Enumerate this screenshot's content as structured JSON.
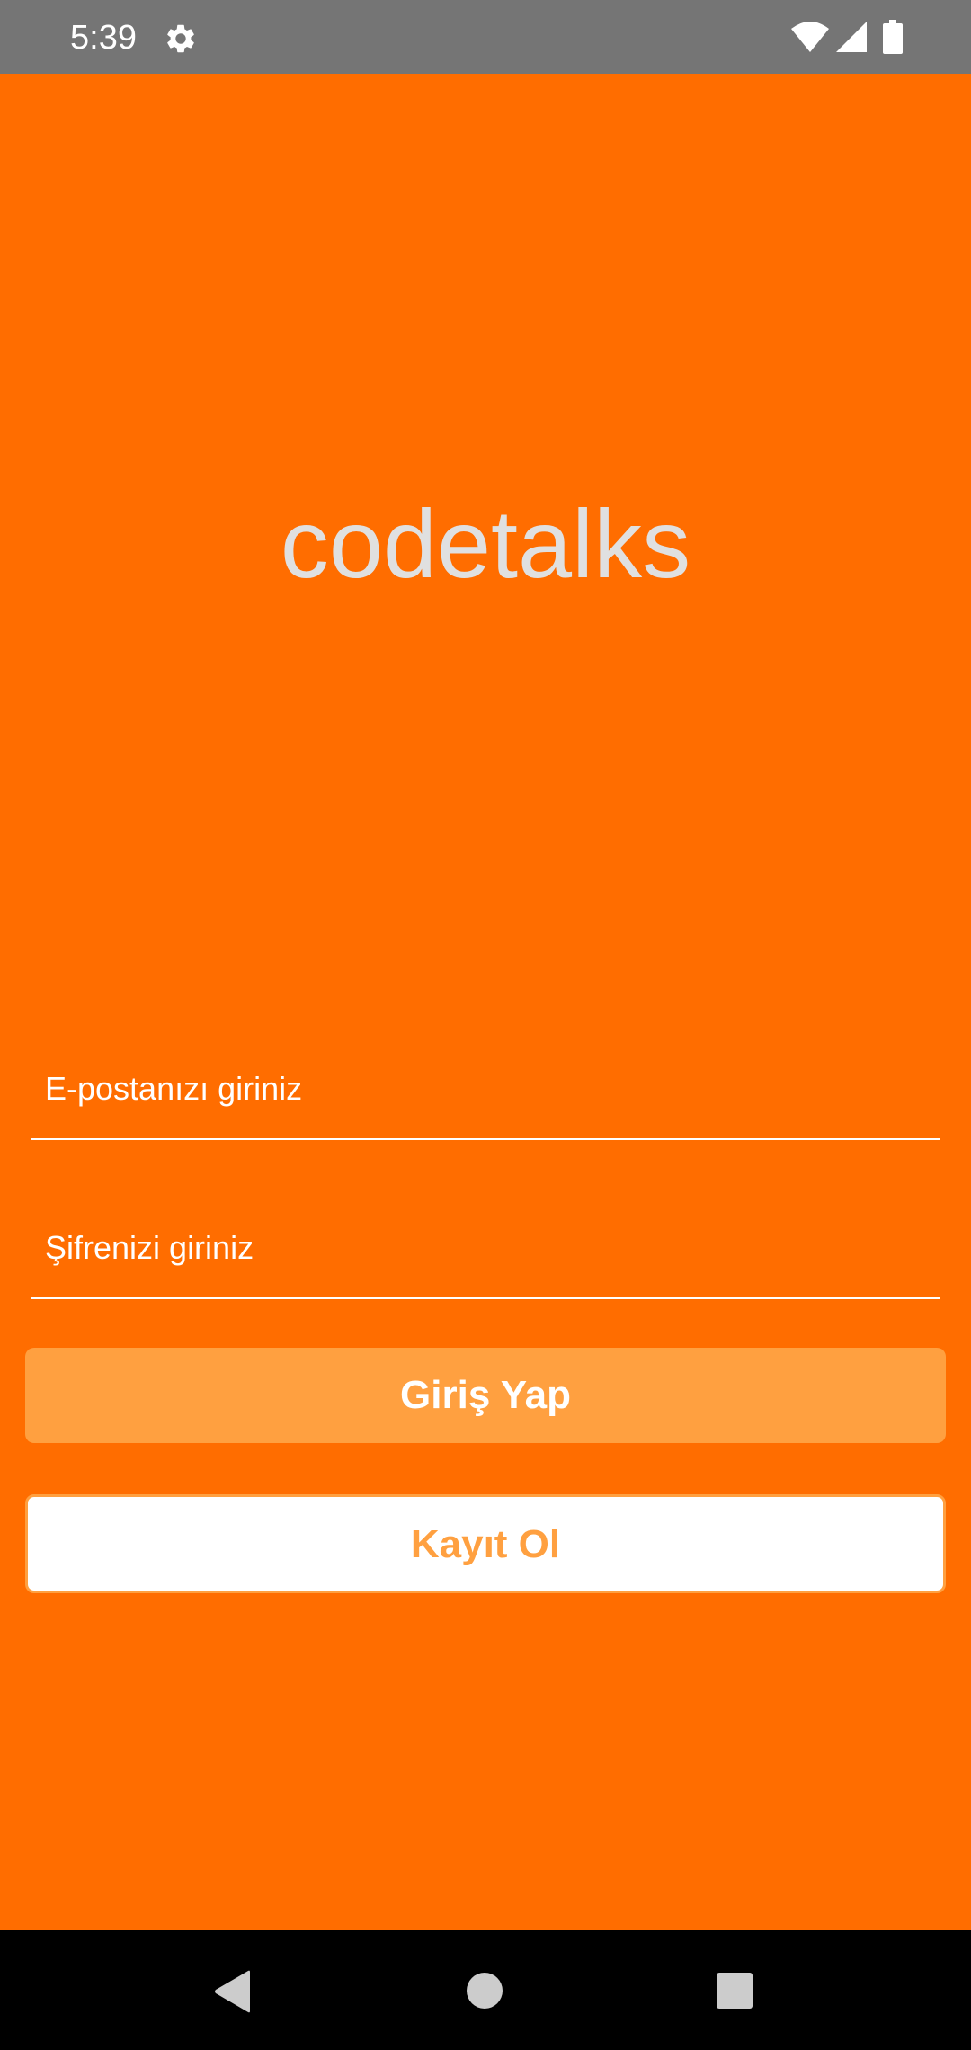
{
  "status_bar": {
    "time": "5:39",
    "icons": [
      "settings-icon",
      "wifi-icon",
      "signal-icon",
      "battery-icon"
    ]
  },
  "app": {
    "logo_text": "codetalks"
  },
  "form": {
    "email_placeholder": "E-postanızı giriniz",
    "email_value": "",
    "password_placeholder": "Şifrenizi giriniz",
    "password_value": "",
    "login_label": "Giriş Yap",
    "register_label": "Kayıt Ol"
  },
  "nav_bar": {
    "icons": [
      "back-icon",
      "home-icon",
      "recents-icon"
    ]
  },
  "colors": {
    "background": "#ff6d00",
    "status_bar": "#757575",
    "button_accent": "#ffa040",
    "logo_text": "#e0e0e0"
  }
}
